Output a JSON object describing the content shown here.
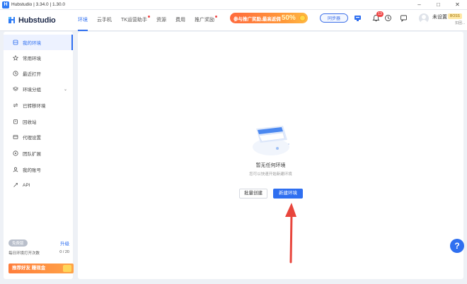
{
  "window": {
    "title": "Hubstudio | 3.34.0 | 1.30.0",
    "controls": [
      "minimize",
      "maximize",
      "close"
    ]
  },
  "header": {
    "logo_text": "Hubstudio",
    "tabs": [
      {
        "label": "环境",
        "active": true
      },
      {
        "label": "云手机",
        "active": false
      },
      {
        "label": "TK运营助手",
        "active": false,
        "dot": true
      },
      {
        "label": "资源",
        "active": false
      },
      {
        "label": "费用",
        "active": false
      },
      {
        "label": "推广奖励",
        "active": false,
        "dot": true
      }
    ],
    "promo": {
      "text": "参与推广奖励,最高返佣",
      "highlight": "50%"
    },
    "sync_button": "同步器",
    "notification_count": "13",
    "user": {
      "name": "未设置",
      "role": "BOSS",
      "sub": "扣团..."
    }
  },
  "sidebar": {
    "items": [
      {
        "label": "我的环境",
        "icon": "database-icon",
        "active": true
      },
      {
        "label": "常用环境",
        "icon": "star-icon"
      },
      {
        "label": "最近打开",
        "icon": "clock-icon"
      },
      {
        "label": "环境分组",
        "icon": "layers-icon",
        "expandable": true
      },
      {
        "label": "已转移环境",
        "icon": "transfer-icon"
      },
      {
        "label": "回收站",
        "icon": "trash-icon"
      },
      {
        "label": "代理设置",
        "icon": "proxy-icon"
      },
      {
        "label": "团队扩展",
        "icon": "extension-icon"
      },
      {
        "label": "我的账号",
        "icon": "user-icon"
      },
      {
        "label": "API",
        "icon": "api-icon"
      }
    ],
    "plan": {
      "tag": "免费版",
      "upgrade": "升级",
      "usage_label": "每日环境打开次数",
      "usage_count": "0 / 20"
    },
    "invite_banner": "推荐好友 赚现金"
  },
  "main": {
    "empty_title": "暂无任何环境",
    "empty_subtitle": "您可以快速开始新建环境",
    "batch_create": "批量创建",
    "new_env": "新建环境"
  },
  "colors": {
    "accent": "#2f6ff0",
    "promo": "#ff7d3b",
    "arrow": "#e8453c"
  },
  "help_label": "?"
}
